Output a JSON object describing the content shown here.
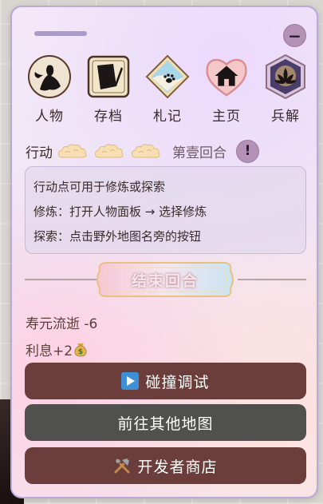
{
  "nav": {
    "items": [
      {
        "label": "人物",
        "icon": "character-icon"
      },
      {
        "label": "存档",
        "icon": "save-icon"
      },
      {
        "label": "札记",
        "icon": "notes-icon"
      },
      {
        "label": "主页",
        "icon": "home-icon"
      },
      {
        "label": "兵解",
        "icon": "lotus-icon"
      }
    ]
  },
  "window": {
    "minimize_label": "−"
  },
  "status": {
    "action_label": "行动",
    "action_points_icon": "auspicious-cloud-icon",
    "action_points": 3,
    "round_label": "第壹回合",
    "info_label": "!"
  },
  "info_box": {
    "lines": [
      "行动点可用于修炼或探索",
      "修炼：打开人物面板 → 选择修炼",
      "探索：点击野外地图名旁的按钮"
    ]
  },
  "end_round": {
    "label": "结束回合"
  },
  "stats": {
    "lifespan": "寿元流逝 -6",
    "interest": "利息+2"
  },
  "buttons": {
    "collision_debug": {
      "icon": "play-icon",
      "label": "碰撞调试"
    },
    "other_maps": {
      "label": "前往其他地图"
    },
    "dev_shop": {
      "icon": "tools-icon",
      "label": "开发者商店"
    }
  },
  "colors": {
    "panel_border": "#b9a8d8",
    "accent_button": "#b491b7",
    "primary_button": "#6b3e3b",
    "secondary_button": "#50514f",
    "text": "#3a2b2b"
  }
}
